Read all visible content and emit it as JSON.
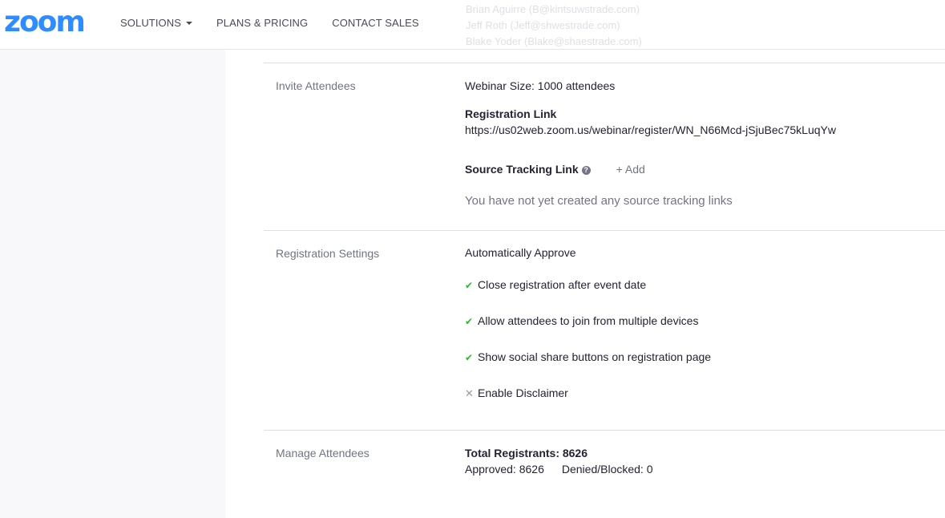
{
  "header": {
    "logo": "zoom",
    "nav": {
      "solutions": "SOLUTIONS",
      "plans": "PLANS & PRICING",
      "contact": "CONTACT SALES"
    }
  },
  "ghost_lines": [
    "Brian Aguirre (B@kintsuwstrade.com)",
    "Jeff Roth (Jeff@shwestrade.com)",
    "Blake Yoder (Blake@shaestrade.com)"
  ],
  "invite": {
    "label": "Invite Attendees",
    "webinar_size": "Webinar Size: 1000 attendees",
    "registration_link_title": "Registration Link",
    "registration_link": "https://us02web.zoom.us/webinar/register/WN_N66Mcd-jSjuBec75kLuqYw",
    "source_tracking_title": "Source Tracking Link",
    "add_label": "+ Add",
    "empty_message": "You have not yet created any source tracking links"
  },
  "registration": {
    "label": "Registration Settings",
    "approve": "Automatically Approve",
    "options": [
      {
        "text": "Close registration after event date",
        "enabled": true
      },
      {
        "text": "Allow attendees to join from multiple devices",
        "enabled": true
      },
      {
        "text": "Show social share buttons on registration page",
        "enabled": true
      },
      {
        "text": "Enable Disclaimer",
        "enabled": false
      }
    ]
  },
  "manage": {
    "label": "Manage Attendees",
    "total": "Total Registrants: 8626",
    "approved": "Approved: 8626",
    "denied": "Denied/Blocked: 0"
  },
  "colors": {
    "brand": "#2d8cff",
    "check": "#2eb82e"
  }
}
